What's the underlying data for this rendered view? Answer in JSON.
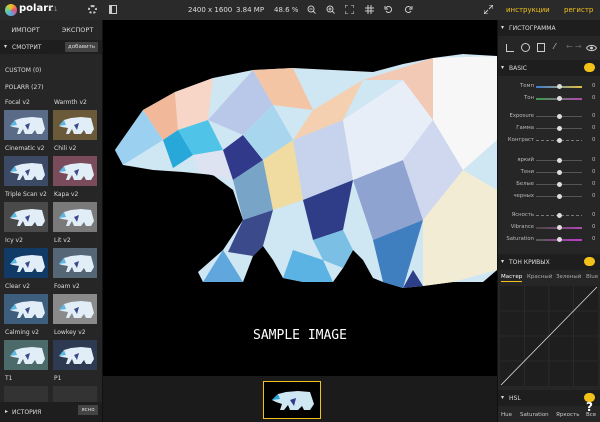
{
  "topbar": {
    "logo": "polarr",
    "version": "3.1",
    "dimensions": "2400 x 1600",
    "megapixels": "3.84 MP",
    "zoom": "48.6 %",
    "link_help": "инструкции",
    "link_register": "регистр"
  },
  "left": {
    "tab_import": "ИМПОРТ",
    "tab_export": "ЭКСПОРТ",
    "section_title": "СМОТРИТ",
    "add_button": "добавить",
    "custom_label": "CUSTOM (0)",
    "polarr_label": "POLARR (27)",
    "presets": [
      {
        "name": "Focal v2",
        "tint": "#5a6b88"
      },
      {
        "name": "Warmth v2",
        "tint": "#6b5a3a"
      },
      {
        "name": "Cinematic v2",
        "tint": "#3c4a66"
      },
      {
        "name": "Chili v2",
        "tint": "#7a4b5a"
      },
      {
        "name": "Triple Scan v2",
        "tint": "#4a4a4a"
      },
      {
        "name": "Kapa v2",
        "tint": "#7a7a7a"
      },
      {
        "name": "Icy v2",
        "tint": "#123a66"
      },
      {
        "name": "Lit v2",
        "tint": "#556677"
      },
      {
        "name": "Clear v2",
        "tint": "#3e5e7e"
      },
      {
        "name": "Foam v2",
        "tint": "#8a8a8a"
      },
      {
        "name": "Calming v2",
        "tint": "#4d6a6a"
      },
      {
        "name": "Lowkey v2",
        "tint": "#2e3a52"
      },
      {
        "name": "T1",
        "tint": "#333333"
      },
      {
        "name": "P1",
        "tint": "#333333"
      }
    ],
    "history_label": "ИСТОРИЯ",
    "clear_button": "ясно"
  },
  "canvas": {
    "sample_text": "SAMPLE IMAGE"
  },
  "right": {
    "histogram_title": "ГИСТОГРАММА",
    "basic_title": "BASIC",
    "sliders": [
      {
        "label": "Темп",
        "value": "0",
        "pos": 0.5,
        "style": "temp"
      },
      {
        "label": "Тон",
        "value": "0",
        "pos": 0.5,
        "style": "tint"
      },
      {
        "label": "Exposure",
        "value": "0",
        "pos": 0.5,
        "style": "plain"
      },
      {
        "label": "Гамма",
        "value": "0",
        "pos": 0.5,
        "style": "plain"
      },
      {
        "label": "Контраст",
        "value": "0",
        "pos": 0.5,
        "style": "dash"
      },
      {
        "label": "яркий",
        "value": "0",
        "pos": 0.5,
        "style": "plain"
      },
      {
        "label": "Тени",
        "value": "0",
        "pos": 0.5,
        "style": "plain"
      },
      {
        "label": "Белые",
        "value": "0",
        "pos": 0.5,
        "style": "plain"
      },
      {
        "label": "черных",
        "value": "0",
        "pos": 0.5,
        "style": "plain"
      },
      {
        "label": "Ясность",
        "value": "0",
        "pos": 0.5,
        "style": "dash"
      },
      {
        "label": "Vibrance",
        "value": "0",
        "pos": 0.5,
        "style": "vib"
      },
      {
        "label": "Saturation",
        "value": "0",
        "pos": 0.5,
        "style": "sat"
      }
    ],
    "curve_title": "ТОН КРИВЫХ",
    "curve_tabs": [
      "Мастер",
      "Красный",
      "Зеленый",
      "Blue"
    ],
    "hsl_title": "HSL",
    "hsl_tabs": [
      "Hue",
      "Saturation",
      "Яркость",
      "Все"
    ]
  },
  "colors": {
    "accent": "#f3c21a"
  }
}
